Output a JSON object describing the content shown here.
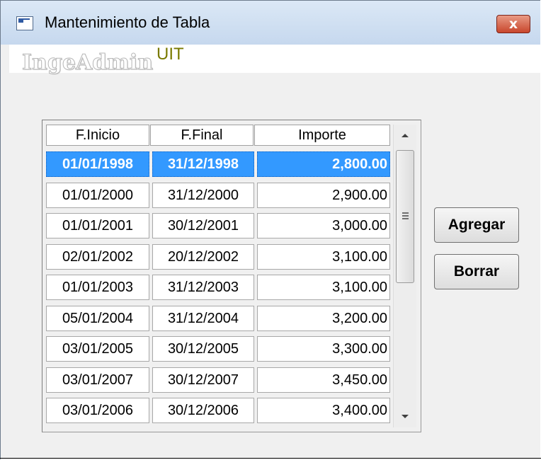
{
  "window": {
    "title": "Mantenimiento de Tabla",
    "close_label": "x"
  },
  "header": {
    "logo_text": "IngeAdmin",
    "table_name": "UIT"
  },
  "table": {
    "columns": [
      "F.Inicio",
      "F.Final",
      "Importe"
    ],
    "selected_row": 0,
    "rows": [
      [
        "01/01/1998",
        "31/12/1998",
        "2,800.00"
      ],
      [
        "01/01/2000",
        "31/12/2000",
        "2,900.00"
      ],
      [
        "01/01/2001",
        "30/12/2001",
        "3,000.00"
      ],
      [
        "02/01/2002",
        "20/12/2002",
        "3,100.00"
      ],
      [
        "01/01/2003",
        "31/12/2003",
        "3,100.00"
      ],
      [
        "05/01/2004",
        "31/12/2004",
        "3,200.00"
      ],
      [
        "03/01/2005",
        "30/12/2005",
        "3,300.00"
      ],
      [
        "03/01/2007",
        "30/12/2007",
        "3,450.00"
      ],
      [
        "03/01/2006",
        "30/12/2006",
        "3,400.00"
      ]
    ]
  },
  "buttons": {
    "add_label": "Agregar",
    "delete_label": "Borrar"
  },
  "colors": {
    "selection": "#3399ff",
    "uit_text": "#7a7a00",
    "titlebar": "#c6d8ee"
  }
}
